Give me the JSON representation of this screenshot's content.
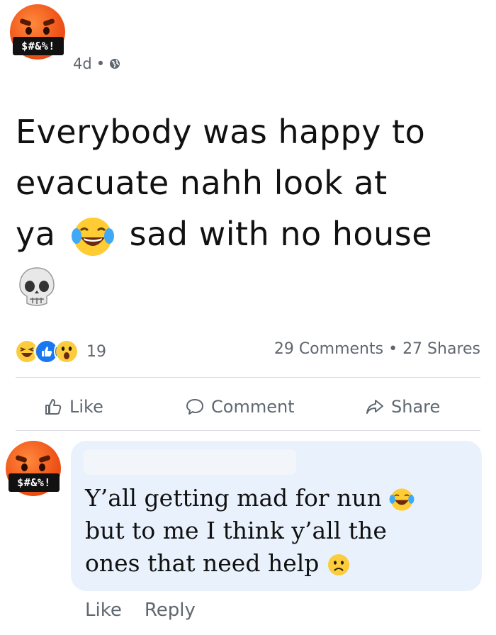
{
  "post": {
    "author_avatar": {
      "emoji": "face-with-symbols-on-mouth",
      "mask_text": "$#&%!"
    },
    "timestamp": "4d",
    "separator": "•",
    "privacy": "globe-icon",
    "text_lines": [
      "Everybody was happy to",
      "evacuate nahh look at",
      "ya",
      "sad with no house"
    ],
    "reactions": {
      "icons": [
        "haha-icon",
        "like-icon",
        "wow-icon"
      ],
      "count": "19"
    },
    "stats": {
      "comments": "29 Comments",
      "dot": "•",
      "shares": "27 Shares"
    },
    "actions": {
      "like": "Like",
      "comment": "Comment",
      "share": "Share"
    }
  },
  "comment": {
    "author_avatar": {
      "emoji": "face-with-symbols-on-mouth",
      "mask_text": "$#&%!"
    },
    "text_lines": [
      "Y’all getting mad for nun",
      "but to me I think y’all the",
      "ones that need help"
    ],
    "actions": {
      "like": "Like",
      "reply": "Reply"
    }
  },
  "colors": {
    "bubble": "#e9f2fc",
    "muted_text": "#606770",
    "divider": "#dadde1"
  }
}
